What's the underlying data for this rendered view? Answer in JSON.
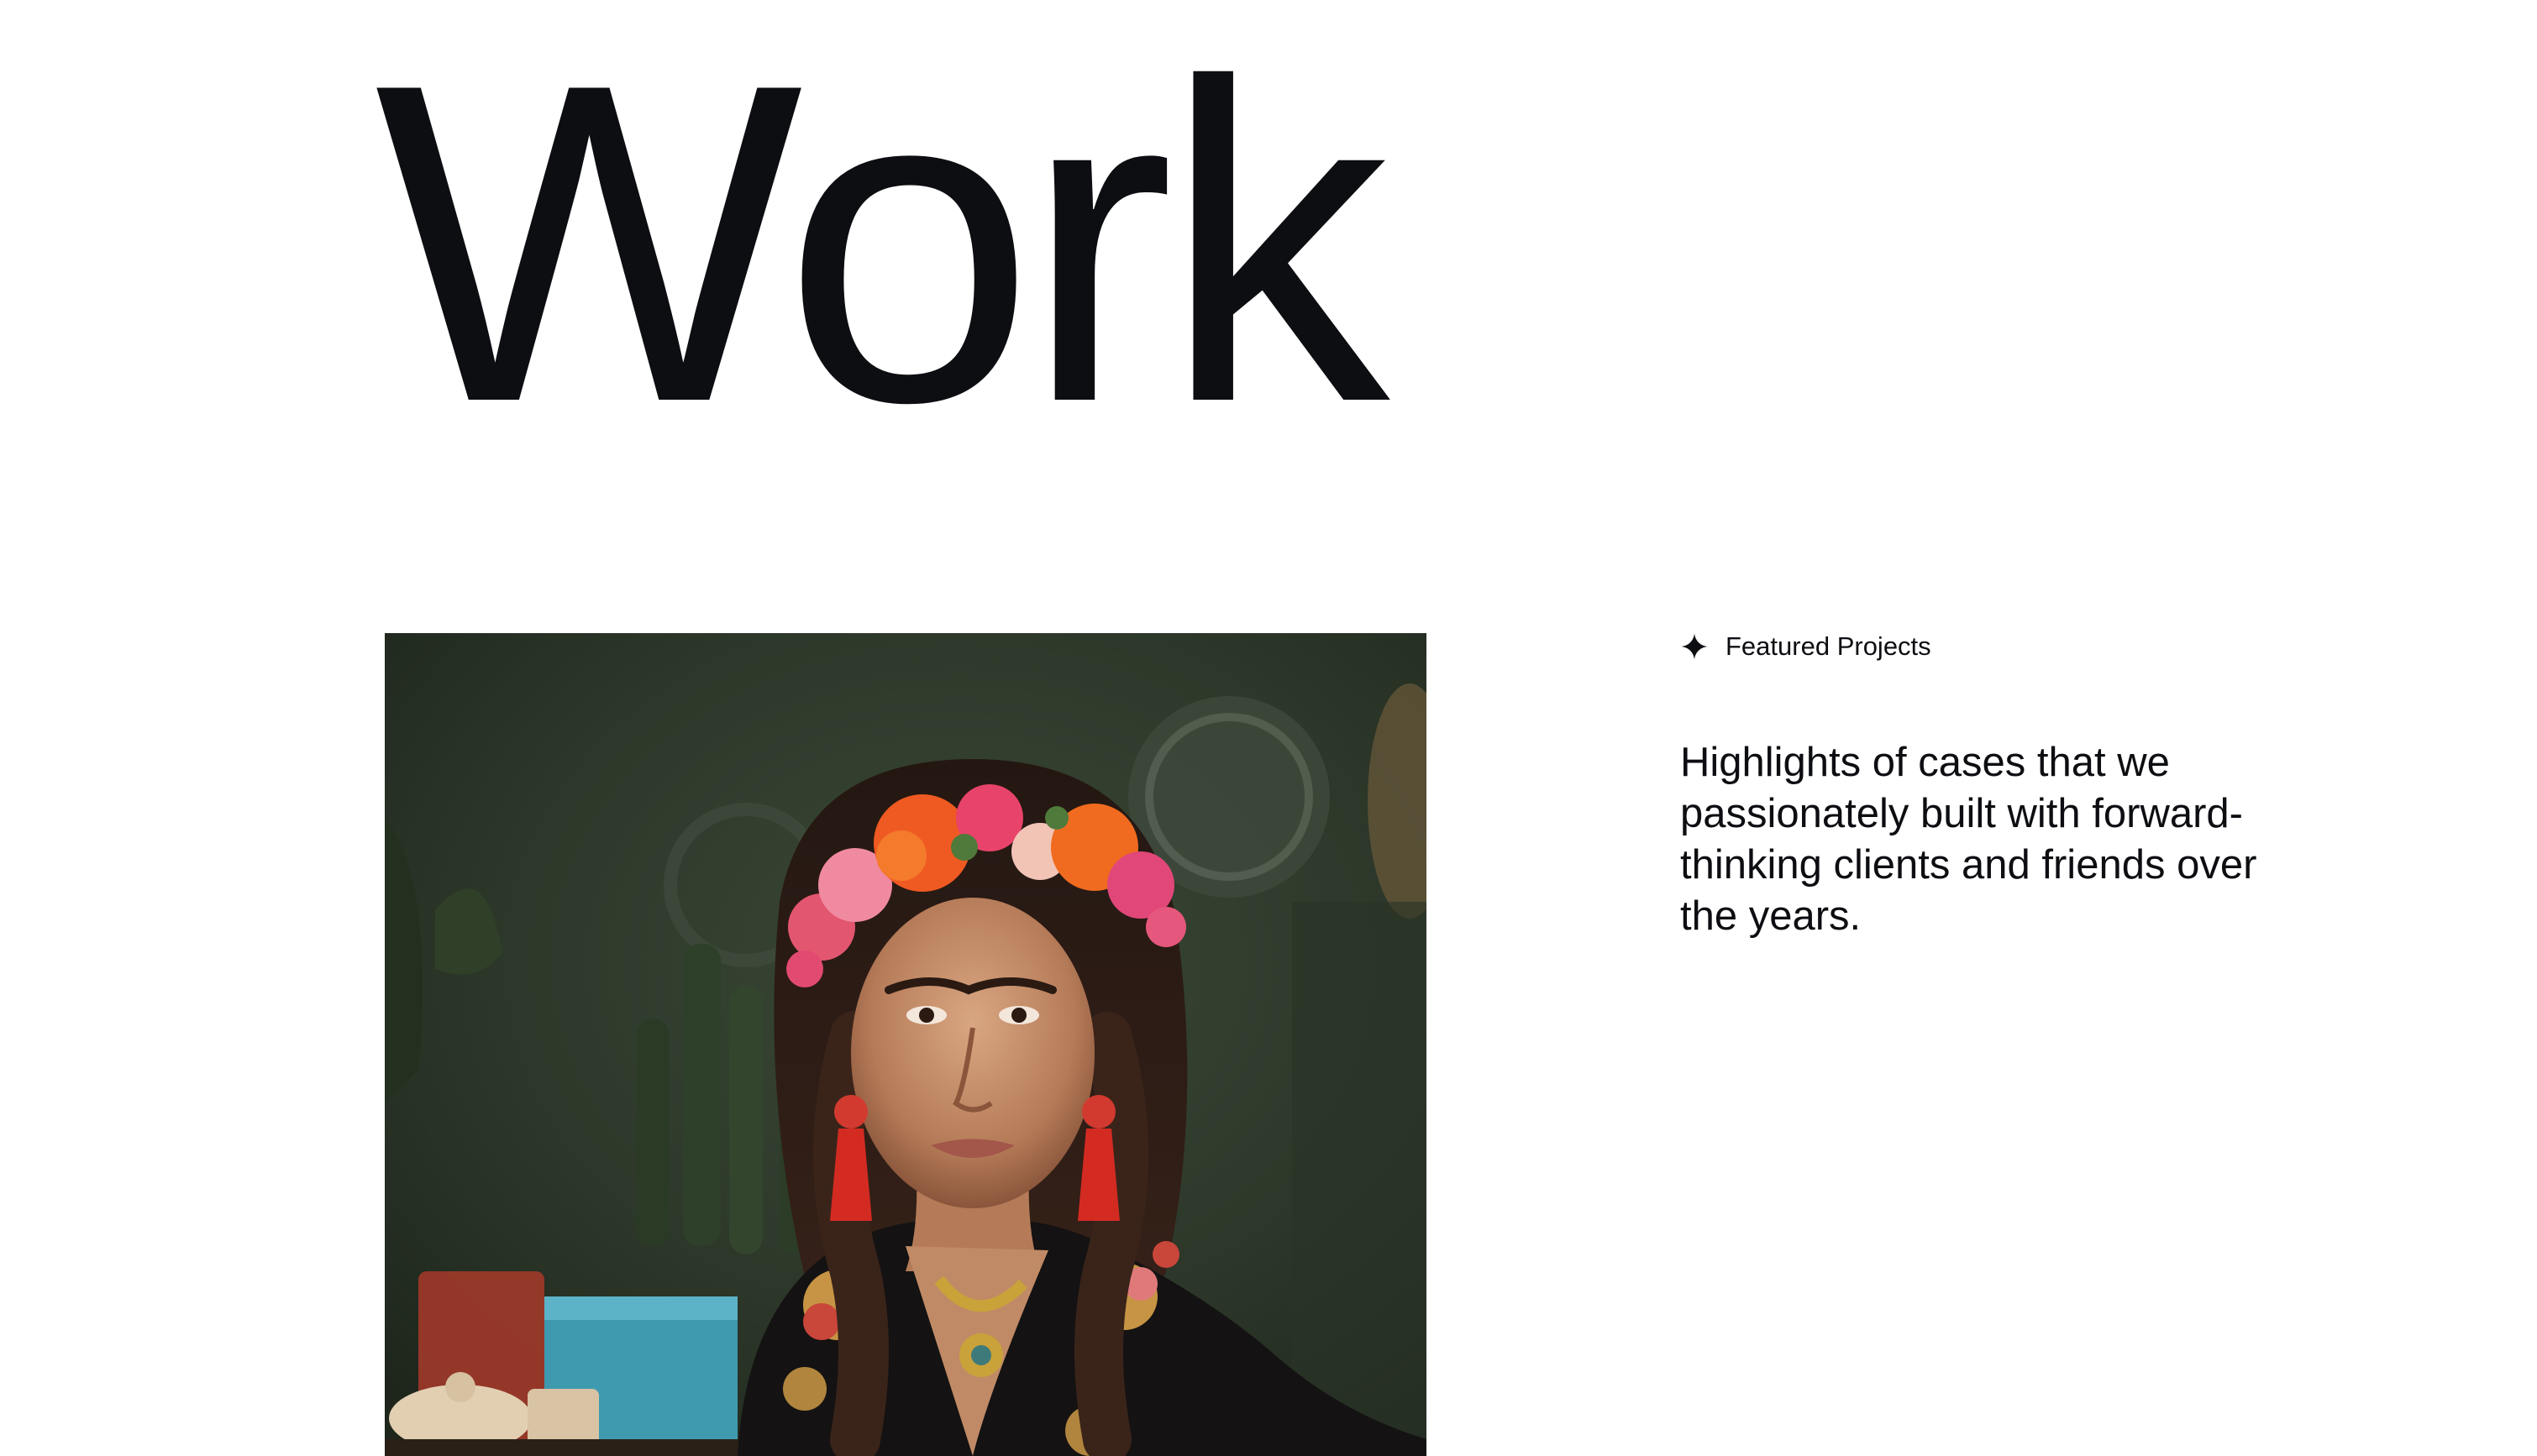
{
  "page": {
    "title": "Work"
  },
  "featured": {
    "label": "Featured Projects",
    "icon": "sparkle-icon",
    "description": "Highlights of cases that we passionately built with forward-thinking clients and friends over the years."
  },
  "project": {
    "image_subject": "portrait-woman-flower-crown"
  },
  "colors": {
    "text": "#0d0e12",
    "background": "#ffffff",
    "image_backdrop": "#2f3a2c"
  }
}
